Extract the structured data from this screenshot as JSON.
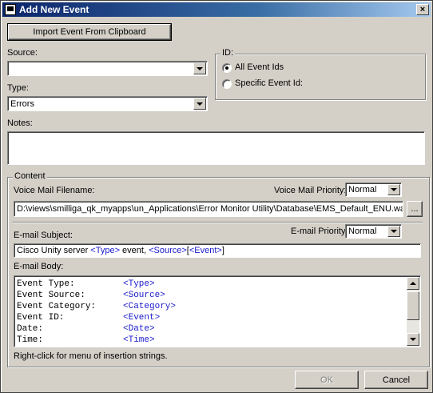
{
  "window": {
    "title": "Add New Event",
    "close_glyph": "×"
  },
  "toolbar": {
    "import_label": "Import Event From Clipboard"
  },
  "source": {
    "label": "Source:",
    "value": ""
  },
  "type": {
    "label": "Type:",
    "value": "Errors"
  },
  "id_group": {
    "title": "ID:",
    "options": [
      {
        "label": "All Event Ids",
        "selected": true
      },
      {
        "label": "Specific Event Id:",
        "selected": false
      }
    ]
  },
  "notes": {
    "label": "Notes:",
    "value": ""
  },
  "content": {
    "title": "Content",
    "voicemail": {
      "filename_label": "Voice Mail Filename:",
      "priority_label": "Voice Mail Priority:",
      "priority_value": "Normal",
      "filename_value": "D:\\views\\smilliga_qk_myapps\\un_Applications\\Error Monitor Utility\\Database\\EMS_Default_ENU.wa",
      "browse_label": "..."
    },
    "email": {
      "subject_label": "E-mail Subject:",
      "priority_label": "E-mail Priority:",
      "priority_value": "Normal",
      "subject_parts": [
        "Cisco Unity server ",
        "<Type>",
        " event, ",
        "<Source>",
        "[",
        "<Event>",
        "]"
      ],
      "body_label": "E-mail Body:",
      "body_rows": [
        {
          "key": "Event Type:",
          "value": "<Type>"
        },
        {
          "key": "Event Source:",
          "value": "<Source>"
        },
        {
          "key": "Event Category:",
          "value": "<Category>"
        },
        {
          "key": "Event ID:",
          "value": "<Event>"
        },
        {
          "key": "Date:",
          "value": "<Date>"
        },
        {
          "key": "Time:",
          "value": "<Time>"
        }
      ]
    },
    "hint": "Right-click for menu of insertion strings."
  },
  "footer": {
    "ok_label": "OK",
    "cancel_label": "Cancel"
  },
  "colors": {
    "title_start": "#0a246a",
    "title_end": "#a6caf0",
    "insertion_string": "#1a1acc",
    "face": "#d4d0c8"
  }
}
